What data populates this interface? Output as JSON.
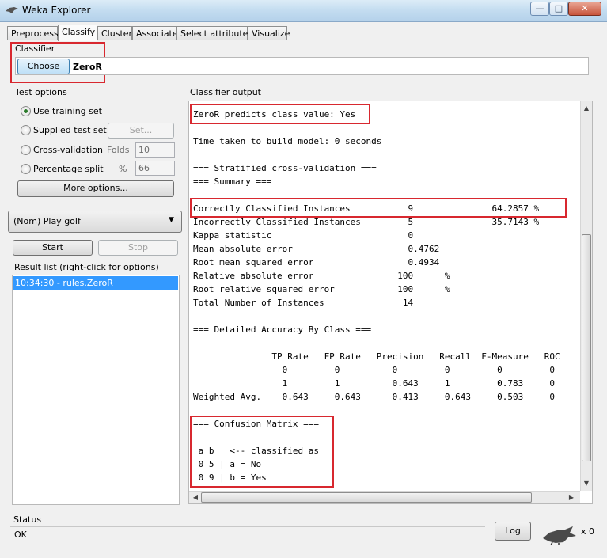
{
  "window": {
    "title": "Weka Explorer"
  },
  "tabs": [
    "Preprocess",
    "Classify",
    "Cluster",
    "Associate",
    "Select attributes",
    "Visualize"
  ],
  "classifier": {
    "group_label": "Classifier",
    "choose_label": "Choose",
    "name": "ZeroR"
  },
  "test_options": {
    "group_label": "Test options",
    "use_training": "Use training set",
    "supplied_test": "Supplied test set",
    "set_button": "Set...",
    "cross_validation": "Cross-validation",
    "folds_label": "Folds",
    "folds_value": "10",
    "percentage_split": "Percentage split",
    "percent_label": "%",
    "percent_value": "66",
    "more_options": "More options..."
  },
  "class_select": {
    "value": "(Nom) Play golf"
  },
  "controls": {
    "start": "Start",
    "stop": "Stop"
  },
  "result_list": {
    "label": "Result list (right-click for options)",
    "items": [
      "10:34:30 - rules.ZeroR"
    ]
  },
  "output": {
    "label": "Classifier output",
    "lines": [
      "ZeroR predicts class value: Yes",
      "",
      "Time taken to build model: 0 seconds",
      "",
      "=== Stratified cross-validation ===",
      "=== Summary ===",
      "",
      "Correctly Classified Instances           9               64.2857 %",
      "Incorrectly Classified Instances         5               35.7143 %",
      "Kappa statistic                          0",
      "Mean absolute error                      0.4762",
      "Root mean squared error                  0.4934",
      "Relative absolute error                100      %",
      "Root relative squared error            100      %",
      "Total Number of Instances               14",
      "",
      "=== Detailed Accuracy By Class ===",
      "",
      "               TP Rate   FP Rate   Precision   Recall  F-Measure   ROC",
      "                 0         0          0         0         0         0",
      "                 1         1          0.643     1         0.783     0",
      "Weighted Avg.    0.643     0.643      0.413     0.643     0.503     0",
      "",
      "=== Confusion Matrix ===",
      "",
      " a b   <-- classified as",
      " 0 5 | a = No",
      " 0 9 | b = Yes"
    ]
  },
  "status": {
    "label": "Status",
    "text": "OK",
    "log_button": "Log",
    "count": "x 0"
  },
  "colors": {
    "highlight": "#d8282f",
    "selection": "#3399ff"
  }
}
